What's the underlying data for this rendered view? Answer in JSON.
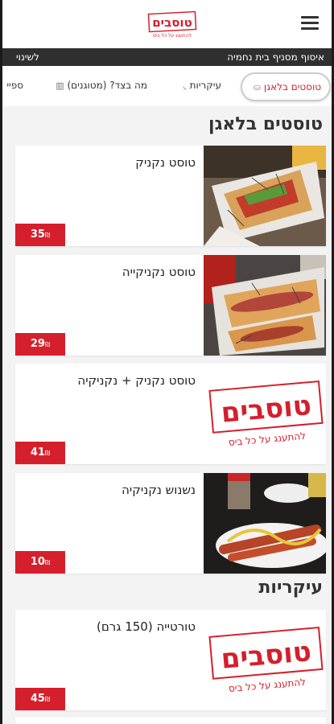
{
  "header": {
    "logo_main": "טוסבים",
    "logo_tag": "להתענג על כל ביס"
  },
  "pickup": {
    "text": "איסוף מסניף בית נחמיה",
    "change": "לשינוי"
  },
  "tabs": [
    {
      "label": "טוסטים בלאגן",
      "active": true
    },
    {
      "label": "עיקריות"
    },
    {
      "label": "מה בצד? (מטוגנים)"
    },
    {
      "label": "ספיי"
    }
  ],
  "sections": [
    {
      "title": "טוסטים בלאגן",
      "items": [
        {
          "name": "טוסט נקניק",
          "price": "35",
          "currency": "₪"
        },
        {
          "name": "טוסט נקניקייה",
          "price": "29",
          "currency": "₪"
        },
        {
          "name": "טוסט נקניק + נקניקיה",
          "price": "41",
          "currency": "₪"
        },
        {
          "name": "נשנוש נקניקיה",
          "price": "10",
          "currency": "₪"
        }
      ]
    },
    {
      "title": "עיקריות",
      "items": [
        {
          "name": "טורטייה (150 גרם)",
          "price": "45",
          "currency": "₪"
        }
      ]
    }
  ],
  "colors": {
    "brand_red": "#d51f2c",
    "bar_dark": "#2f2f2f"
  }
}
